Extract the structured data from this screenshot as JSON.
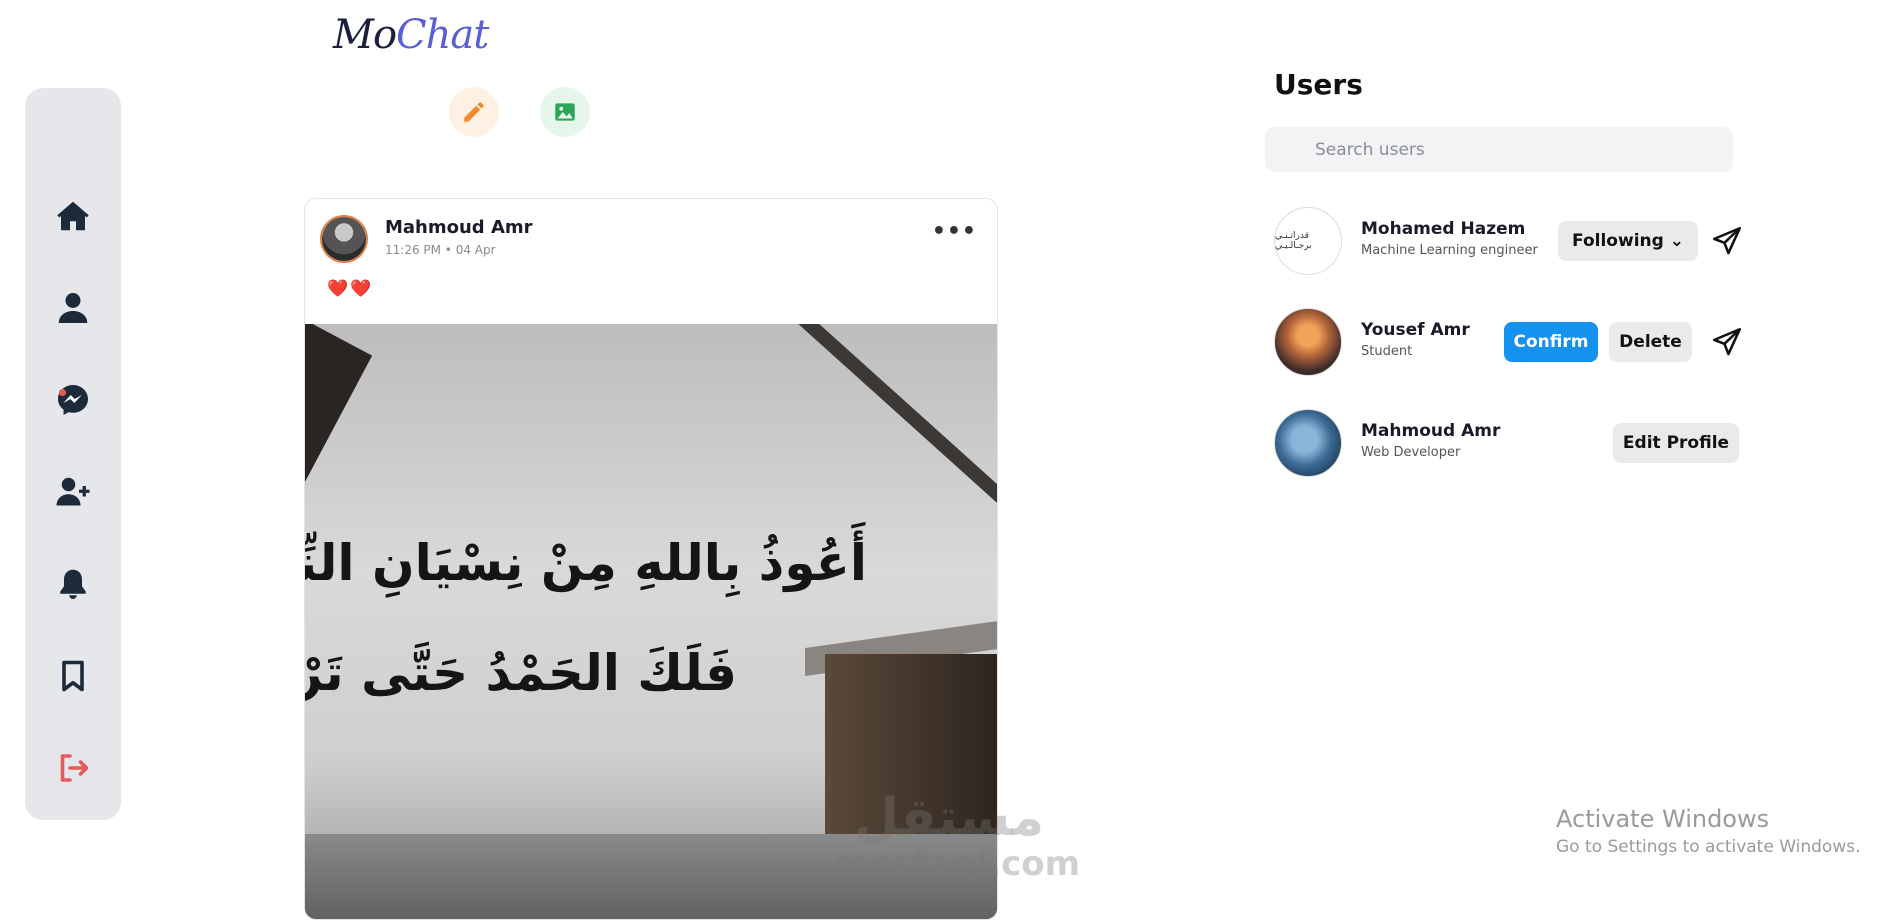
{
  "app": {
    "logo_part1": "Mo",
    "logo_part2": "Chat"
  },
  "colors": {
    "sidebar_bg": "#e6e7eb",
    "nav_icon": "#1c2a3a",
    "logout_icon": "#e85a5a",
    "edit_accent": "#f08a2c",
    "image_accent": "#2aa65a",
    "confirm_button": "#1591ee"
  },
  "sidebar": {
    "items": [
      {
        "icon": "home-icon"
      },
      {
        "icon": "user-icon"
      },
      {
        "icon": "messenger-icon"
      },
      {
        "icon": "add-user-icon"
      },
      {
        "icon": "bell-icon"
      },
      {
        "icon": "bookmark-icon"
      },
      {
        "icon": "logout-icon"
      }
    ]
  },
  "composer": {
    "edit_icon": "pencil-icon",
    "image_icon": "image-icon"
  },
  "post": {
    "author": "Mahmoud Amr",
    "time": "11:26 PM • 04 Apr",
    "text": "❤️❤️",
    "image_line1": "أَعُوذُ بِاللهِ مِنْ نِسْيَانِ النِّعَمِ",
    "image_line2": "فَلَكَ الحَمْدُ حَتَّى تَرْضَى",
    "menu_label": "•••"
  },
  "watermark": {
    "line1": "مستقل",
    "line2": "mostaql.com"
  },
  "users_panel": {
    "title": "Users",
    "search_placeholder": "Search users",
    "users": [
      {
        "name": "Mohamed Hazem",
        "role": "Machine Learning engineer",
        "avatar_text": "قدراتـنـي برجـالـيـي",
        "action": "Following ⌄"
      },
      {
        "name": "Yousef Amr",
        "role": "Student",
        "confirm": "Confirm",
        "delete": "Delete"
      },
      {
        "name": "Mahmoud Amr",
        "role": "Web Developer",
        "action": "Edit Profile"
      }
    ]
  },
  "system": {
    "activate_title": "Activate Windows",
    "activate_sub": "Go to Settings to activate Windows."
  }
}
